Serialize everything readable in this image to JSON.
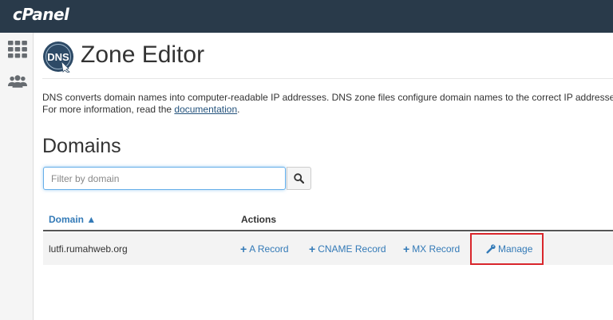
{
  "topbar": {
    "logo": "cPanel"
  },
  "sidebar": {
    "icons": [
      "grid-icon",
      "users-icon"
    ]
  },
  "header": {
    "title": "Zone Editor",
    "icon": "dns-icon"
  },
  "description": {
    "line1": "DNS converts domain names into computer-readable IP addresses. DNS zone files configure domain names to the correct IP addresses.",
    "line2_prefix": "For more information, read the ",
    "line2_link": "documentation",
    "line2_suffix": "."
  },
  "domains": {
    "title": "Domains",
    "filter": {
      "placeholder": "Filter by domain",
      "value": ""
    },
    "table": {
      "columns": {
        "domain": "Domain ▲",
        "actions": "Actions"
      },
      "rows": [
        {
          "domain": "lutfi.rumahweb.org",
          "actions": {
            "a_record": "A Record",
            "cname_record": "CNAME Record",
            "mx_record": "MX Record",
            "manage": "Manage"
          }
        }
      ]
    }
  },
  "colors": {
    "topbar": "#293a4a",
    "link": "#337ab7",
    "highlight": "#d9262c"
  }
}
